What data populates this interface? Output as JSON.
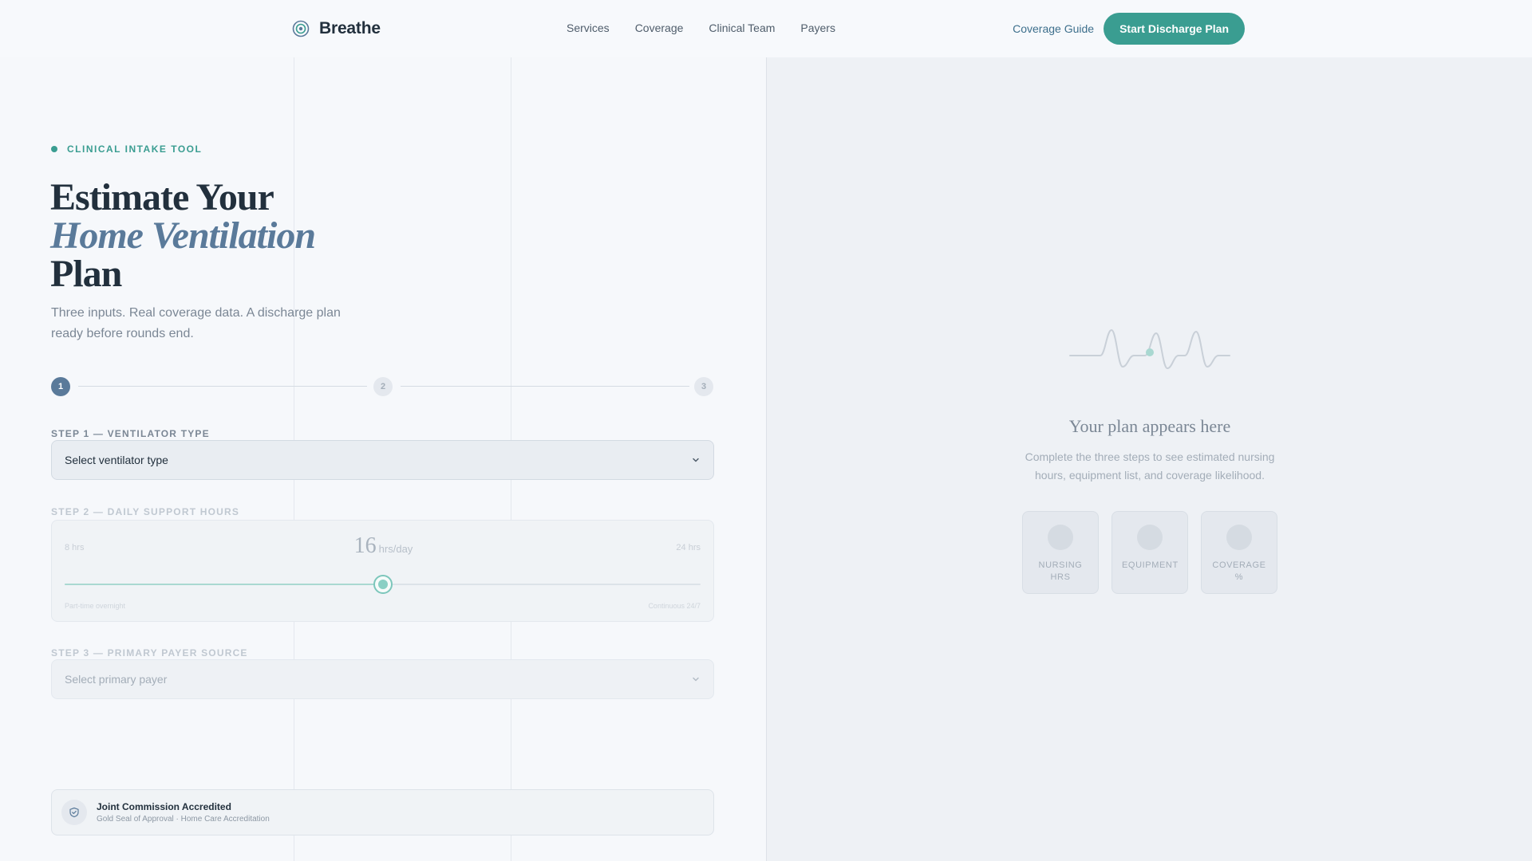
{
  "header": {
    "brand_name": "Breathe",
    "nav": [
      "Services",
      "Coverage",
      "Clinical Team",
      "Payers"
    ],
    "guide_link": "Coverage Guide",
    "cta_label": "Start Discharge Plan"
  },
  "hero": {
    "eyebrow": "CLINICAL INTAKE TOOL",
    "title_line1": "Estimate Your",
    "title_accent": "Home Ventilation",
    "title_line3": "Plan",
    "subtitle": "Three inputs. Real coverage data. A discharge plan ready before rounds end."
  },
  "stepper": {
    "steps": [
      "1",
      "2",
      "3"
    ],
    "current": 1
  },
  "step1": {
    "label": "STEP 1 — VENTILATOR TYPE",
    "select_value": "Select ventilator type"
  },
  "step2": {
    "label": "STEP 2 — DAILY SUPPORT HOURS",
    "min_label": "8 hrs",
    "max_label": "24 hrs",
    "value": "16",
    "unit": "hrs/day",
    "min": 8,
    "max": 24,
    "current": 16,
    "caption_left": "Part-time overnight",
    "caption_right": "Continuous 24/7"
  },
  "step3": {
    "label": "STEP 3 — PRIMARY PAYER SOURCE",
    "select_value": "Select primary payer"
  },
  "badge": {
    "title": "Joint Commission Accredited",
    "subtitle": "Gold Seal of Approval · Home Care Accreditation"
  },
  "result": {
    "title": "Your plan appears here",
    "text": "Complete the three steps to see estimated nursing hours, equipment list, and coverage likelihood.",
    "tiles": [
      "NURSING HRS",
      "EQUIPMENT",
      "COVERAGE %"
    ]
  },
  "colors": {
    "accent": "#3a9d91",
    "primary": "#5a7a9a",
    "text": "#22303d"
  },
  "icons": {
    "brand": "breathe-logo-icon",
    "select": "chevron-down-icon",
    "badge": "shield-icon",
    "placeholder": "heartbeat-icon"
  }
}
